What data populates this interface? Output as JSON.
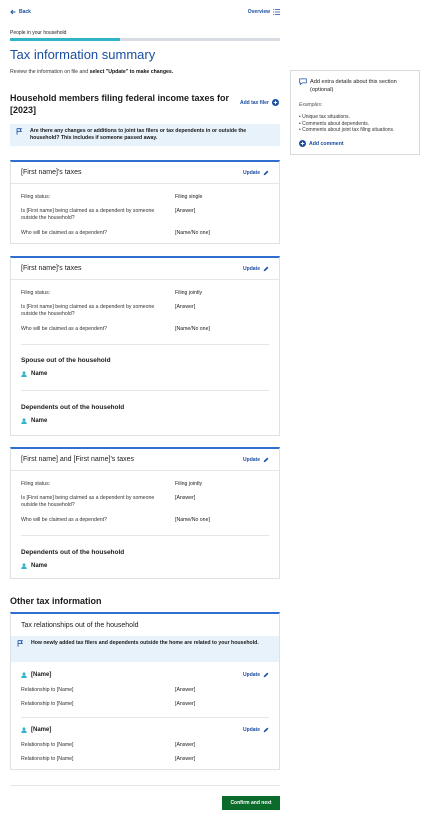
{
  "nav": {
    "back": "Back",
    "overview": "Overview"
  },
  "section_label": "People in your household",
  "page_title": "Tax information summary",
  "subtitle_pre": "Review the information on file and ",
  "subtitle_bold": "select \"Update\" to make changes.",
  "filers_heading": "Household members filing federal income taxes for [2023]",
  "add_tax_filer": "Add tax filer",
  "alert_top": "Are there any changes or additions to joint tax filers or tax dependents in or outside the household? This includes if someone passed away.",
  "update_label": "Update",
  "labels": {
    "filing_status": "Filing status:",
    "claimed": "Is [First name] being claimed as a dependent by someone outside the household?",
    "who_claimed": "Who will be claimed as a dependent?",
    "relationship": "Relationship to [Name]"
  },
  "cards": [
    {
      "title": "[First name]'s taxes",
      "filing": "Filing single",
      "claimed": "[Answer]",
      "who": "[Name/No one]"
    },
    {
      "title": "[First name]'s taxes",
      "filing": "Filing jointly",
      "claimed": "[Answer]",
      "who": "[Name/No one]",
      "spouse_heading": "Spouse out of the household",
      "spouse_name": "Name",
      "dependents_heading": "Dependents out of the household",
      "dependent_name": "Name"
    },
    {
      "title": "[First name] and [First name]'s taxes",
      "filing": "Filing jointly",
      "claimed": "[Answer]",
      "who": "[Name/No one]",
      "dependents_heading": "Dependents out of the household",
      "dependent_name": "Name"
    }
  ],
  "other_heading": "Other tax information",
  "relationships_card": {
    "title": "Tax relationships out of the household",
    "alert": "How newly added tax filers and dependents outside the home are related to your household.",
    "people": [
      {
        "name": "[Name]",
        "rows": [
          "[Answer]",
          "[Answer]"
        ]
      },
      {
        "name": "[Name]",
        "rows": [
          "[Answer]",
          "[Answer]"
        ]
      }
    ]
  },
  "sidebar": {
    "question": "Add extra details about this section (optional)",
    "examples_label": "Examples:",
    "examples": [
      "Unique tax situations.",
      "Comments about dependents.",
      "Comments about joint tax filing situations."
    ],
    "add_comment": "Add comment"
  },
  "confirm_button": "Confirm and next",
  "colors": {
    "accent": "#1a4ea1",
    "progress": "#2fb5c7",
    "alert_bg": "#e7f2fb",
    "confirm": "#0b6b2a"
  }
}
